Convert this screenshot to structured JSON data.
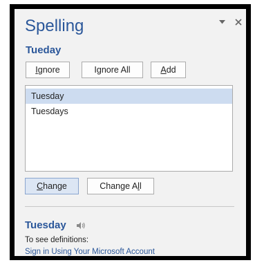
{
  "pane": {
    "title": "Spelling",
    "misspelled_word": "Tueday"
  },
  "buttons": {
    "ignore": {
      "accel": "I",
      "rest": "gnore"
    },
    "ignore_all": {
      "pre": "I",
      "accel": "g",
      "rest": "nore All"
    },
    "add": {
      "accel": "A",
      "rest": "dd"
    },
    "change": {
      "accel": "C",
      "rest": "hange"
    },
    "change_all": {
      "pre": "Change A",
      "accel": "l",
      "rest": "l"
    }
  },
  "suggestions": [
    {
      "text": "Tuesday",
      "selected": true
    },
    {
      "text": "Tuesdays",
      "selected": false
    }
  ],
  "definition": {
    "word": "Tuesday",
    "label": "To see definitions:",
    "link": "Sign in Using Your Microsoft Account"
  },
  "icons": {
    "options": "chevron-down-icon",
    "close": "close-icon",
    "speaker": "speaker-icon"
  },
  "colors": {
    "accent": "#2b579a",
    "pane_bg": "#f2f2f2",
    "selection": "#cddcf0",
    "border": "#ababab",
    "frame": "#000000"
  }
}
